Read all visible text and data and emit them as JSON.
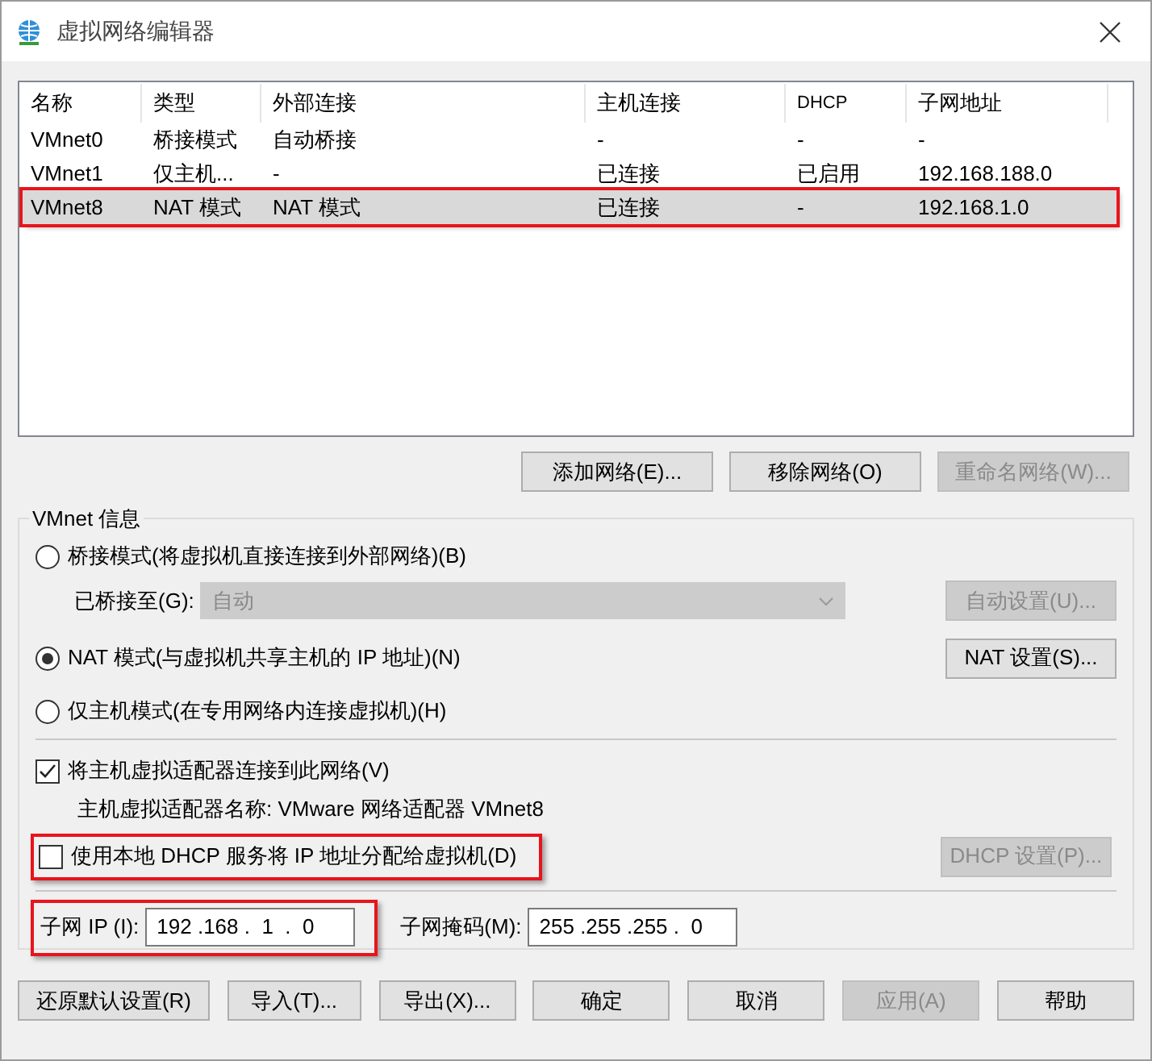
{
  "window": {
    "title": "虚拟网络编辑器"
  },
  "table": {
    "columns": [
      "名称",
      "类型",
      "外部连接",
      "主机连接",
      "DHCP",
      "子网地址"
    ],
    "rows": [
      {
        "cells": [
          "VMnet0",
          "桥接模式",
          "自动桥接",
          "-",
          "-",
          "-"
        ],
        "selected": false,
        "highlighted": false
      },
      {
        "cells": [
          "VMnet1",
          "仅主机...",
          "-",
          "已连接",
          "已启用",
          "192.168.188.0"
        ],
        "selected": false,
        "highlighted": false
      },
      {
        "cells": [
          "VMnet8",
          "NAT 模式",
          "NAT 模式",
          "已连接",
          "-",
          "192.168.1.0"
        ],
        "selected": true,
        "highlighted": true
      }
    ]
  },
  "table_buttons": [
    {
      "label": "添加网络(E)...",
      "disabled": false
    },
    {
      "label": "移除网络(O)",
      "disabled": false
    },
    {
      "label": "重命名网络(W)...",
      "disabled": true
    }
  ],
  "vmnet_info": {
    "title": "VMnet 信息",
    "modes": [
      {
        "label": "桥接模式(将虚拟机直接连接到外部网络)(B)",
        "selected": false
      },
      {
        "label": "NAT 模式(与虚拟机共享主机的 IP 地址)(N)",
        "selected": true
      },
      {
        "label": "仅主机模式(在专用网络内连接虚拟机)(H)",
        "selected": false
      }
    ],
    "bridged_to": {
      "label": "已桥接至(G):",
      "value": "自动",
      "disabled": true
    },
    "auto_settings_button": {
      "label": "自动设置(U)...",
      "disabled": true
    },
    "nat_settings_button": {
      "label": "NAT 设置(S)...",
      "disabled": false
    },
    "connect_adapter": {
      "label": "将主机虚拟适配器连接到此网络(V)",
      "checked": true
    },
    "adapter_name": "主机虚拟适配器名称: VMware 网络适配器 VMnet8",
    "dhcp": {
      "label": "使用本地 DHCP 服务将 IP 地址分配给虚拟机(D)",
      "checked": false,
      "highlighted": true
    },
    "dhcp_settings_button": {
      "label": "DHCP 设置(P)...",
      "disabled": true
    },
    "subnet_ip": {
      "label": "子网 IP (I):",
      "value": "192 .168 .  1  .  0",
      "highlighted": true
    },
    "subnet_mask": {
      "label": "子网掩码(M):",
      "value": "255 .255 .255 .  0"
    }
  },
  "buttons": [
    {
      "label": "还原默认设置(R)",
      "disabled": false
    },
    {
      "label": "导入(T)...",
      "disabled": false
    },
    {
      "label": "导出(X)...",
      "disabled": false
    },
    {
      "label": "确定",
      "disabled": false
    },
    {
      "label": "取消",
      "disabled": false
    },
    {
      "label": "应用(A)",
      "disabled": true
    },
    {
      "label": "帮助",
      "disabled": false
    }
  ]
}
